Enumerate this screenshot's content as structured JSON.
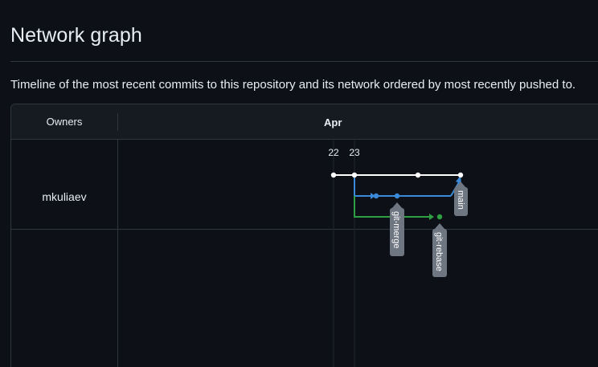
{
  "page": {
    "title": "Network graph",
    "description": "Timeline of the most recent commits to this repository and its network ordered by most recently pushed to."
  },
  "graph": {
    "owners_label": "Owners",
    "month": "Apr",
    "days": [
      "22",
      "23"
    ],
    "owners": [
      {
        "name": "mkuliaev"
      }
    ],
    "branches": [
      {
        "name": "main",
        "color": "#ffffff"
      },
      {
        "name": "git-merge",
        "color": "#3b8ad9"
      },
      {
        "name": "git-rebase",
        "color": "#2ea043"
      }
    ],
    "label_color": "#6e7681"
  }
}
